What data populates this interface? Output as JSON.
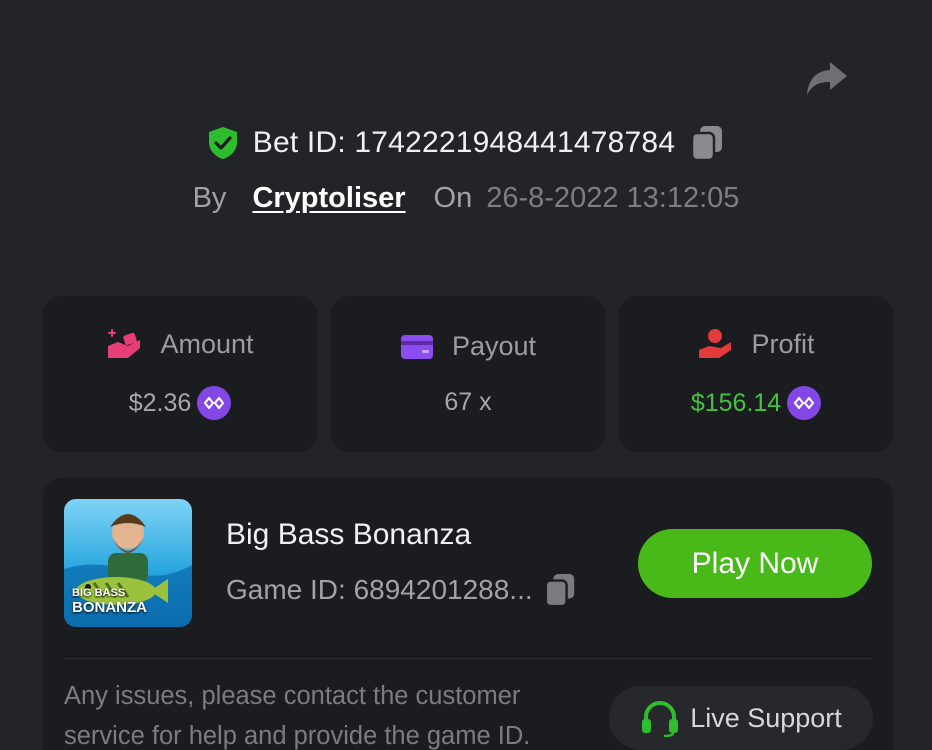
{
  "bet": {
    "id_label": "Bet ID: 1742221948441478784",
    "by_label": "By",
    "user": "Cryptoliser",
    "on_label": "On",
    "date": "26-8-2022 13:12:05"
  },
  "stats": [
    {
      "label": "Amount",
      "value": "$2.36",
      "icon": "money-hand-icon",
      "coin": "polygon-coin-icon"
    },
    {
      "label": "Payout",
      "value": "67 x",
      "icon": "credit-card-icon"
    },
    {
      "label": "Profit",
      "value": "$156.14",
      "icon": "profit-user-icon",
      "coin": "polygon-coin-icon"
    }
  ],
  "game": {
    "title": "Big Bass Bonanza",
    "id_label": "Game ID: 6894201288...",
    "thumb_text_1": "BIG BASS",
    "thumb_text_2": "BONANZA",
    "play_label": "Play Now"
  },
  "help": {
    "text": "Any issues, please contact the customer service for help and provide the game ID.",
    "support_label": "Live Support"
  },
  "colors": {
    "background": "#232428",
    "card": "#1b1c1f",
    "play_green": "#49b819",
    "profit_green": "#44c43c",
    "coin_purple": "#8247e5",
    "shield_green": "#2ebd2e",
    "payout_purple": "#8b4cf0",
    "amount_pink": "#e83e77",
    "profit_red": "#e23b3b"
  }
}
